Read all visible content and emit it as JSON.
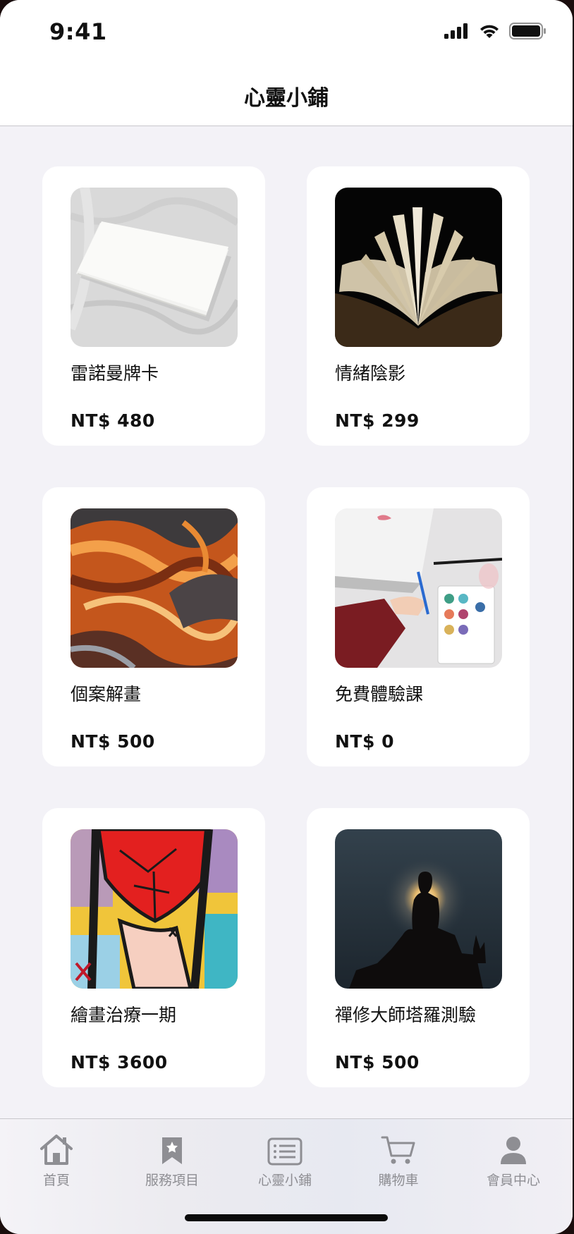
{
  "status_bar": {
    "time": "9:41"
  },
  "nav": {
    "title": "心靈小鋪"
  },
  "products": [
    {
      "name": "雷諾曼牌卡",
      "price": "NT$ 480",
      "image": "blank-cards-photo"
    },
    {
      "name": "情緒陰影",
      "price": "NT$ 299",
      "image": "open-book-photo"
    },
    {
      "name": "個案解畫",
      "price": "NT$ 500",
      "image": "fluid-art-photo"
    },
    {
      "name": "免費體驗課",
      "price": "NT$ 0",
      "image": "watercolor-painting-photo"
    },
    {
      "name": "繪畫治療一期",
      "price": "NT$ 3600",
      "image": "heart-art-photo"
    },
    {
      "name": "禪修大師塔羅測驗",
      "price": "NT$ 500",
      "image": "buddha-silhouette-photo"
    }
  ],
  "tabs": [
    {
      "label": "首頁",
      "icon": "home-icon"
    },
    {
      "label": "服務項目",
      "icon": "bookmark-star-icon"
    },
    {
      "label": "心靈小鋪",
      "icon": "list-icon"
    },
    {
      "label": "購物車",
      "icon": "cart-icon"
    },
    {
      "label": "會員中心",
      "icon": "person-icon"
    }
  ]
}
